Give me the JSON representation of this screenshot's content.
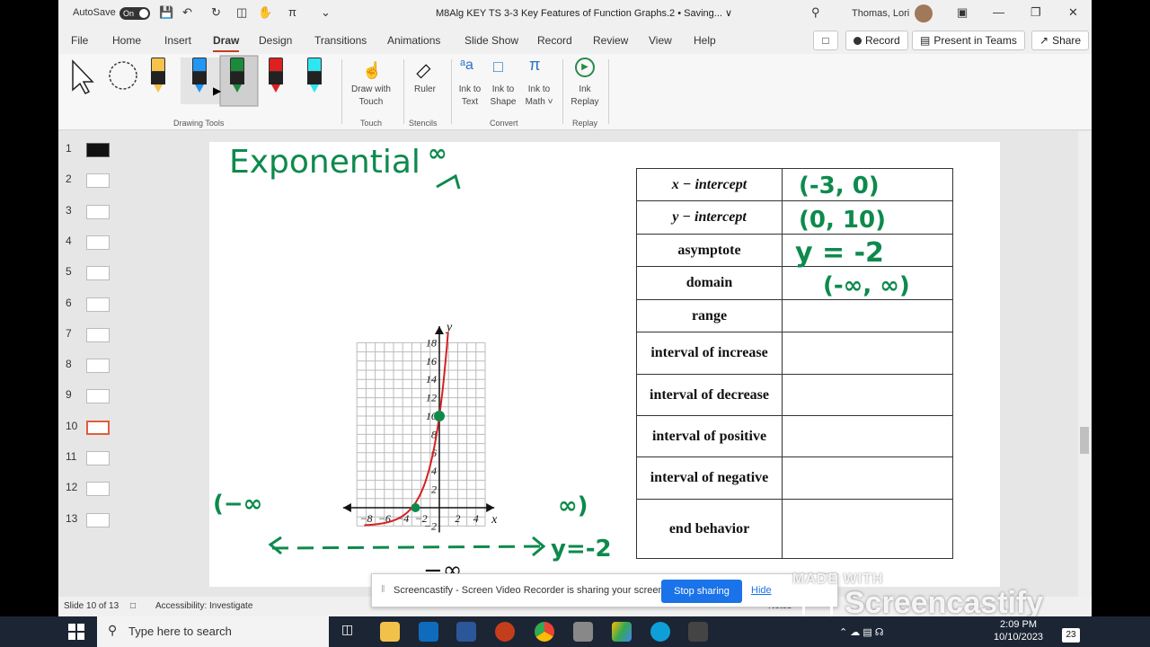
{
  "titlebar": {
    "autosave_label": "AutoSave",
    "autosave_state": "On",
    "document_title": "M8Alg KEY TS 3-3 Key Features of Function Graphs.2 • Saving... ∨",
    "user_name": "Thomas, Lori"
  },
  "menu": {
    "items": [
      "File",
      "Home",
      "Insert",
      "Draw",
      "Design",
      "Transitions",
      "Animations",
      "Slide Show",
      "Record",
      "Review",
      "View",
      "Help"
    ],
    "active": "Draw",
    "record_label": "Record",
    "present_label": "Present in Teams",
    "share_label": "Share"
  },
  "ribbon": {
    "drawing_tools_group": "Drawing Tools",
    "draw_with_touch": "Draw with Touch",
    "touch_group": "Touch",
    "ruler": "Ruler",
    "stencils_group": "Stencils",
    "ink_to_text": "Ink to Text",
    "ink_to_shape": "Ink to Shape",
    "ink_to_math": "Ink to Math ˅",
    "convert_group": "Convert",
    "ink_replay": "Ink Replay",
    "replay_group": "Replay",
    "pen_colors": [
      "#f5c24a",
      "#2196f3",
      "#1b8a3a",
      "#e02020",
      "#2ee6f0"
    ]
  },
  "thumbnails": {
    "numbers": [
      "1",
      "2",
      "3",
      "4",
      "5",
      "6",
      "7",
      "8",
      "9",
      "10",
      "11",
      "12",
      "13"
    ],
    "selected": "10"
  },
  "slide": {
    "graph": {
      "y_label": "y",
      "x_label": "x",
      "y_ticks": [
        "18",
        "16",
        "14",
        "12",
        "10",
        "8",
        "6",
        "4",
        "2",
        "−2"
      ],
      "x_ticks": [
        "−8",
        "−6",
        "−4",
        "−2",
        "2",
        "4"
      ]
    },
    "table": [
      {
        "label": "x − intercept",
        "value": "(-3, 0)"
      },
      {
        "label": "y − intercept",
        "value": "(0, 10)"
      },
      {
        "label": "asymptote",
        "value": "y = -2"
      },
      {
        "label": "domain",
        "value": "(-∞, ∞)"
      },
      {
        "label": "range",
        "value": ""
      },
      {
        "label": "interval of increase",
        "value": ""
      },
      {
        "label": "interval of decrease",
        "value": ""
      },
      {
        "label": "interval of positive",
        "value": ""
      },
      {
        "label": "interval of negative",
        "value": ""
      },
      {
        "label": "end behavior",
        "value": ""
      }
    ],
    "ink": {
      "title": "Exponential",
      "top_inf": "∞",
      "left_inf": "(−∞",
      "right_inf": "∞)",
      "bottom_inf": "−∞",
      "asymptote_label": "y=-2"
    }
  },
  "status": {
    "slide_info": "Slide 10 of 13",
    "accessibility": "Accessibility: Investigate",
    "notes": "Notes"
  },
  "banner": {
    "message": "Screencastify - Screen Video Recorder is sharing your screen.",
    "stop_label": "Stop sharing",
    "hide_label": "Hide"
  },
  "watermark": {
    "small": "MADE WITH",
    "big": "Screencastify"
  },
  "taskbar": {
    "search_placeholder": "Type here to search",
    "time": "2:09 PM",
    "date": "10/10/2023",
    "notif_count": "23"
  }
}
